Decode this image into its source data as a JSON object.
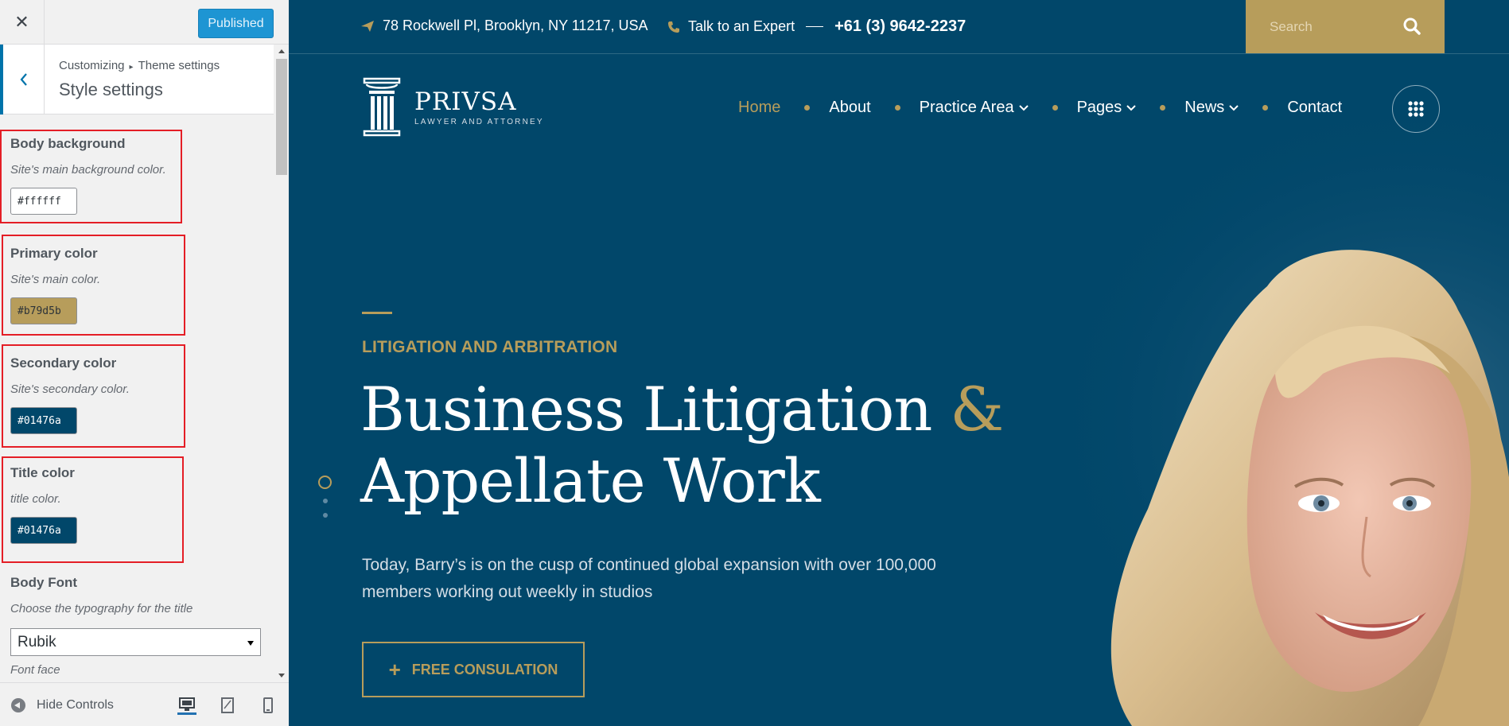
{
  "customizer": {
    "close_glyph": "✕",
    "publish_label": "Published",
    "breadcrumb": [
      "Customizing",
      "Theme settings"
    ],
    "breadcrumb_sep": "▸",
    "section_title": "Style settings",
    "controls": [
      {
        "title": "Body background",
        "desc": "Site's main background color.",
        "value": "#ffffff",
        "swatch": "#ffffff",
        "text_color": "#2c3338"
      },
      {
        "title": "Primary color",
        "desc": "Site's main color.",
        "value": "#b79d5b",
        "swatch": "#b79d5b",
        "text_color": "#2c3338"
      },
      {
        "title": "Secondary color",
        "desc": "Site's secondary color.",
        "value": "#01476a",
        "swatch": "#01476a",
        "text_color": "#ffffff"
      },
      {
        "title": "Title color",
        "desc": "title color.",
        "value": "#01476a",
        "swatch": "#01476a",
        "text_color": "#ffffff"
      }
    ],
    "body_font": {
      "title": "Body Font",
      "desc": "Choose the typography for the title",
      "selected": "Rubik",
      "subdesc": "Font face"
    },
    "footer": {
      "hide_controls": "Hide Controls",
      "devices": [
        "desktop-icon",
        "tablet-icon",
        "mobile-icon"
      ]
    }
  },
  "site": {
    "address": "78 Rockwell Pl, Brooklyn, NY 11217, USA",
    "talk_label": "Talk to an Expert",
    "phone": "+61 (3) 9642-2237",
    "search_placeholder": "Search",
    "logo": {
      "name": "PRIVSA",
      "tagline": "LAWYER AND ATTORNEY"
    },
    "nav": [
      {
        "label": "Home",
        "active": true,
        "dropdown": false
      },
      {
        "label": "About",
        "active": false,
        "dropdown": false
      },
      {
        "label": "Practice Area",
        "active": false,
        "dropdown": true
      },
      {
        "label": "Pages",
        "active": false,
        "dropdown": true
      },
      {
        "label": "News",
        "active": false,
        "dropdown": true
      },
      {
        "label": "Contact",
        "active": false,
        "dropdown": false
      }
    ],
    "hero": {
      "kicker": "LITIGATION AND ARBITRATION",
      "title_line1": "Business Litigation",
      "title_amp": "&",
      "title_line2": "Appellate Work",
      "text": "Today, Barry’s is on the cusp of continued global expansion with over 100,000 members working out weekly in studios",
      "cta_plus": "+",
      "cta_label": "FREE CONSULATION"
    },
    "colors": {
      "primary": "#b79d5b",
      "secondary": "#01476a"
    }
  }
}
